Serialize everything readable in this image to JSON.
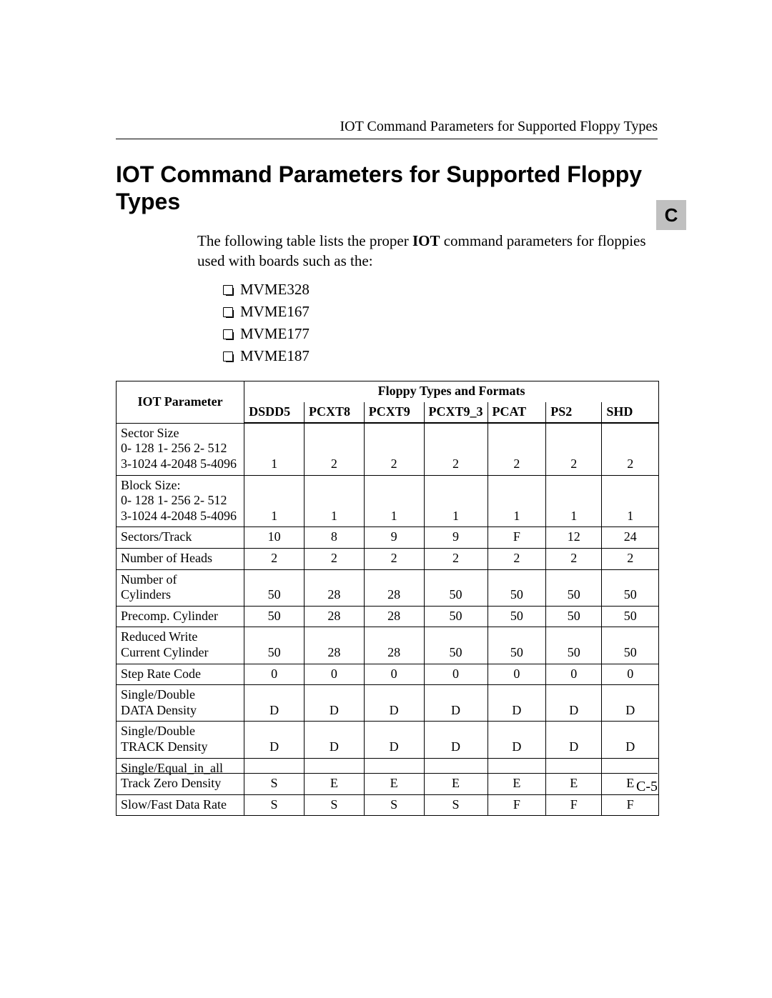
{
  "running_head": "IOT Command Parameters for Supported Floppy Types",
  "section_letter": "C",
  "title": "IOT Command Parameters for Supported Floppy Types",
  "intro_pre": "The following table lists the proper ",
  "intro_bold": "IOT",
  "intro_post": " command parameters for floppies used with boards such as the:",
  "boards": [
    "MVME328",
    "MVME167",
    "MVME177",
    "MVME187"
  ],
  "table": {
    "iot_header": "IOT Parameter",
    "formats_header": "Floppy Types and Formats",
    "columns": [
      "DSDD5",
      "PCXT8",
      "PCXT9",
      "PCXT9_3",
      "PCAT",
      "PS2",
      "SHD"
    ],
    "chart_data": {
      "type": "table",
      "columns": [
        "IOT Parameter",
        "DSDD5",
        "PCXT8",
        "PCXT9",
        "PCXT9_3",
        "PCAT",
        "PS2",
        "SHD"
      ],
      "rows": [
        {
          "label_lines": [
            "Sector Size",
            "0- 128 1- 256 2- 512",
            "3-1024 4-2048 5-4096"
          ],
          "values": [
            "1",
            "2",
            "2",
            "2",
            "2",
            "2",
            "2"
          ]
        },
        {
          "label_lines": [
            "Block Size:",
            "0- 128 1- 256 2- 512",
            "3-1024 4-2048 5-4096"
          ],
          "values": [
            "1",
            "1",
            "1",
            "1",
            "1",
            "1",
            "1"
          ]
        },
        {
          "label_lines": [
            "Sectors/Track"
          ],
          "values": [
            "10",
            "8",
            "9",
            "9",
            "F",
            "12",
            "24"
          ]
        },
        {
          "label_lines": [
            "Number of Heads"
          ],
          "values": [
            "2",
            "2",
            "2",
            "2",
            "2",
            "2",
            "2"
          ]
        },
        {
          "label_lines": [
            "Number of",
            "Cylinders"
          ],
          "values": [
            "50",
            "28",
            "28",
            "50",
            "50",
            "50",
            "50"
          ]
        },
        {
          "label_lines": [
            "Precomp. Cylinder"
          ],
          "values": [
            "50",
            "28",
            "28",
            "50",
            "50",
            "50",
            "50"
          ]
        },
        {
          "label_lines": [
            "Reduced Write",
            "Current Cylinder"
          ],
          "values": [
            "50",
            "28",
            "28",
            "50",
            "50",
            "50",
            "50"
          ]
        },
        {
          "label_lines": [
            "Step Rate Code"
          ],
          "values": [
            "0",
            "0",
            "0",
            "0",
            "0",
            "0",
            "0"
          ]
        },
        {
          "label_lines": [
            "Single/Double",
            "DATA Density"
          ],
          "values": [
            "D",
            "D",
            "D",
            "D",
            "D",
            "D",
            "D"
          ]
        },
        {
          "label_lines": [
            "Single/Double",
            "TRACK Density"
          ],
          "values": [
            "D",
            "D",
            "D",
            "D",
            "D",
            "D",
            "D"
          ]
        },
        {
          "label_lines": [
            "Single/Equal_in_all",
            "Track Zero Density"
          ],
          "values": [
            "S",
            "E",
            "E",
            "E",
            "E",
            "E",
            "E"
          ]
        },
        {
          "label_lines": [
            "Slow/Fast Data Rate"
          ],
          "values": [
            "S",
            "S",
            "S",
            "S",
            "F",
            "F",
            "F"
          ]
        }
      ]
    }
  },
  "page_number": "C-5"
}
